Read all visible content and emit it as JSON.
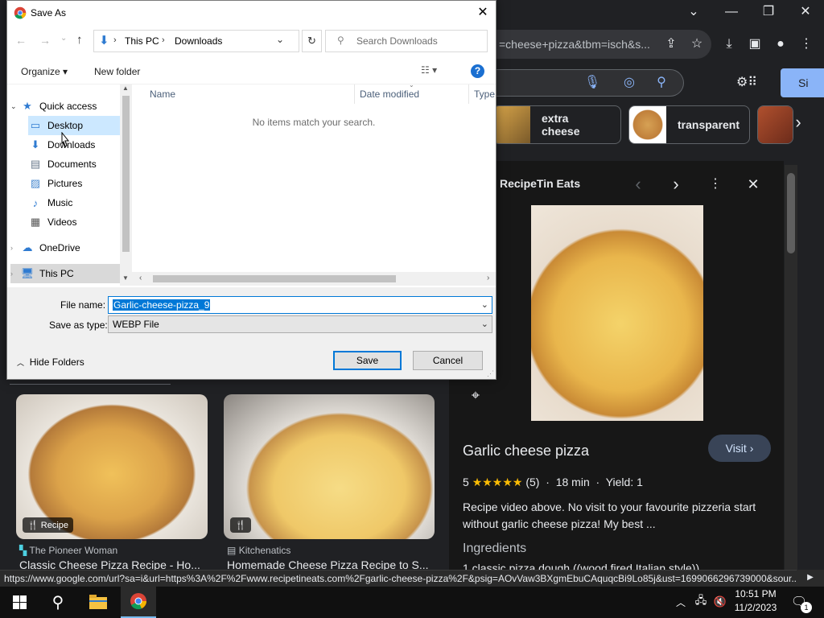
{
  "browser": {
    "url_fragment": "=cheese+pizza&tbm=isch&s...",
    "signin_label": "Si",
    "chips": [
      "extra cheese",
      "transparent"
    ],
    "status_url": "https://www.google.com/url?sa=i&url=https%3A%2F%2Fwww.recipetineats.com%2Fgarlic-cheese-pizza%2F&psig=AOvVaw3BXgmEbuCAquqcBi9Lo85j&ust=1699066296739000&sour..."
  },
  "side_panel": {
    "source": "RecipeTin Eats",
    "title": "Garlic cheese pizza",
    "visit_label": "Visit",
    "rating_value": "5",
    "stars": "★★★★★",
    "rating_count": "(5)",
    "time": "18 min",
    "yield": "Yield: 1",
    "description": "Recipe video above. No visit to your favourite pizzeria start without garlic cheese pizza! My best ...",
    "ingredients_heading": "Ingredients",
    "ingredient_partial": "1 classic pizza dough ((wood fired Italian style))"
  },
  "results": [
    {
      "badge": "Recipe",
      "source": "The Pioneer Woman",
      "title": "Classic Cheese Pizza Recipe - Ho..."
    },
    {
      "badge": "",
      "source": "Kitchenatics",
      "title": "Homemade Cheese Pizza Recipe to S..."
    }
  ],
  "dialog": {
    "title": "Save As",
    "path": [
      "This PC",
      "Downloads"
    ],
    "search_placeholder": "Search Downloads",
    "organize_label": "Organize",
    "new_folder_label": "New folder",
    "nav": {
      "quick_access": "Quick access",
      "items": [
        "Desktop",
        "Downloads",
        "Documents",
        "Pictures",
        "Music",
        "Videos"
      ],
      "onedrive": "OneDrive",
      "this_pc": "This PC"
    },
    "columns": [
      "Name",
      "Date modified",
      "Type"
    ],
    "empty_message": "No items match your search.",
    "file_name_label": "File name:",
    "file_name_value": "Garlic-cheese-pizza_9",
    "save_type_label": "Save as type:",
    "save_type_value": "WEBP File",
    "hide_folders_label": "Hide Folders",
    "save_label": "Save",
    "cancel_label": "Cancel"
  },
  "taskbar": {
    "time": "10:51 PM",
    "date": "11/2/2023",
    "notification_count": "1"
  },
  "colors": {
    "accent": "#0078d7",
    "selection": "#cce8ff",
    "chrome_bg": "#202124"
  }
}
